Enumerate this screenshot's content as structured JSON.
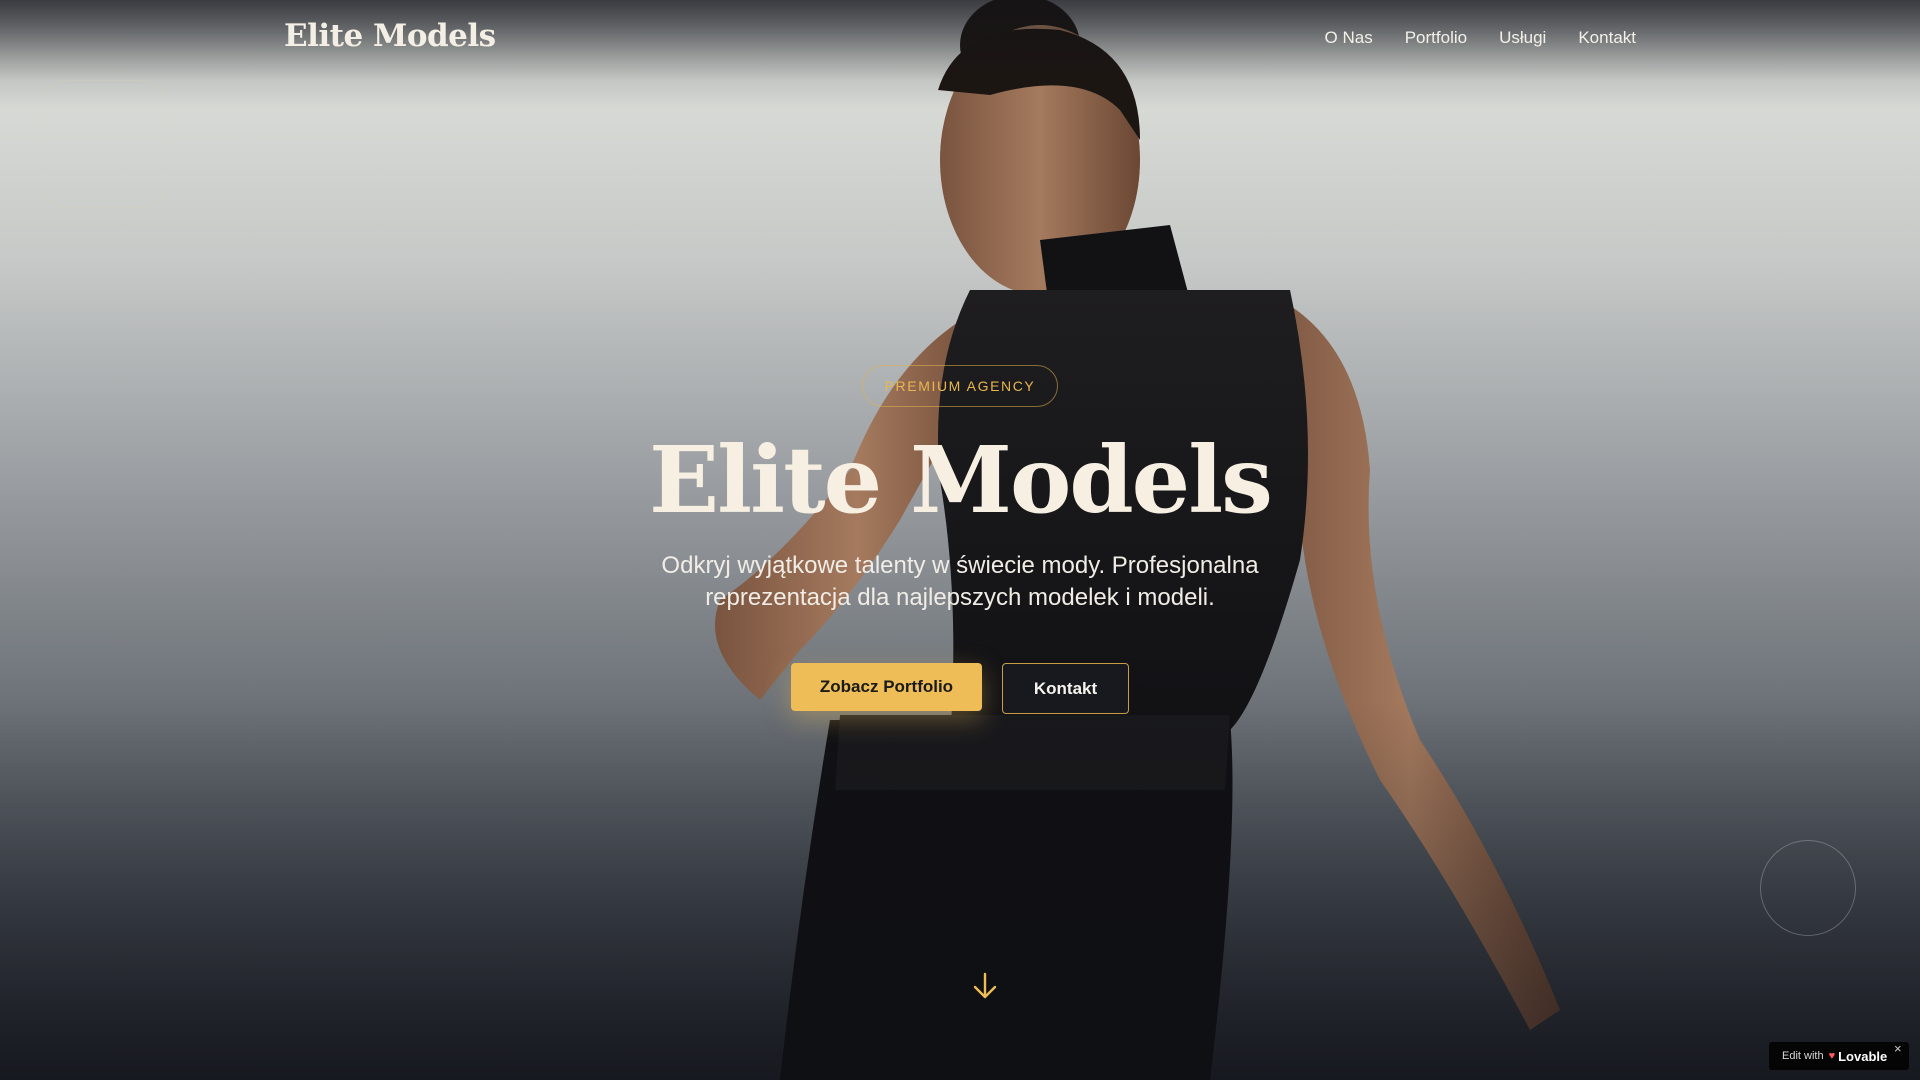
{
  "navbar": {
    "logo": "Elite Models",
    "links": [
      "O Nas",
      "Portfolio",
      "Usługi",
      "Kontakt"
    ]
  },
  "hero": {
    "badge": "PREMIUM AGENCY",
    "title": "Elite Models",
    "subtitle_line1": "Odkryj wyjątkowe talenty w świecie mody. Profesjonalna",
    "subtitle_line2": "reprezentacja dla najlepszych modelek i modeli.",
    "primary_button": "Zobacz Portfolio",
    "secondary_button": "Kontakt",
    "scroll_icon": "arrow-down-icon"
  },
  "lovable_badge": {
    "prefix": "Edit with",
    "brand": "Lovable",
    "close": "×"
  },
  "colors": {
    "accent": "#eebd57",
    "badge_text": "#e9b64f",
    "title": "#f6efe2",
    "background_dark": "#23262d"
  }
}
